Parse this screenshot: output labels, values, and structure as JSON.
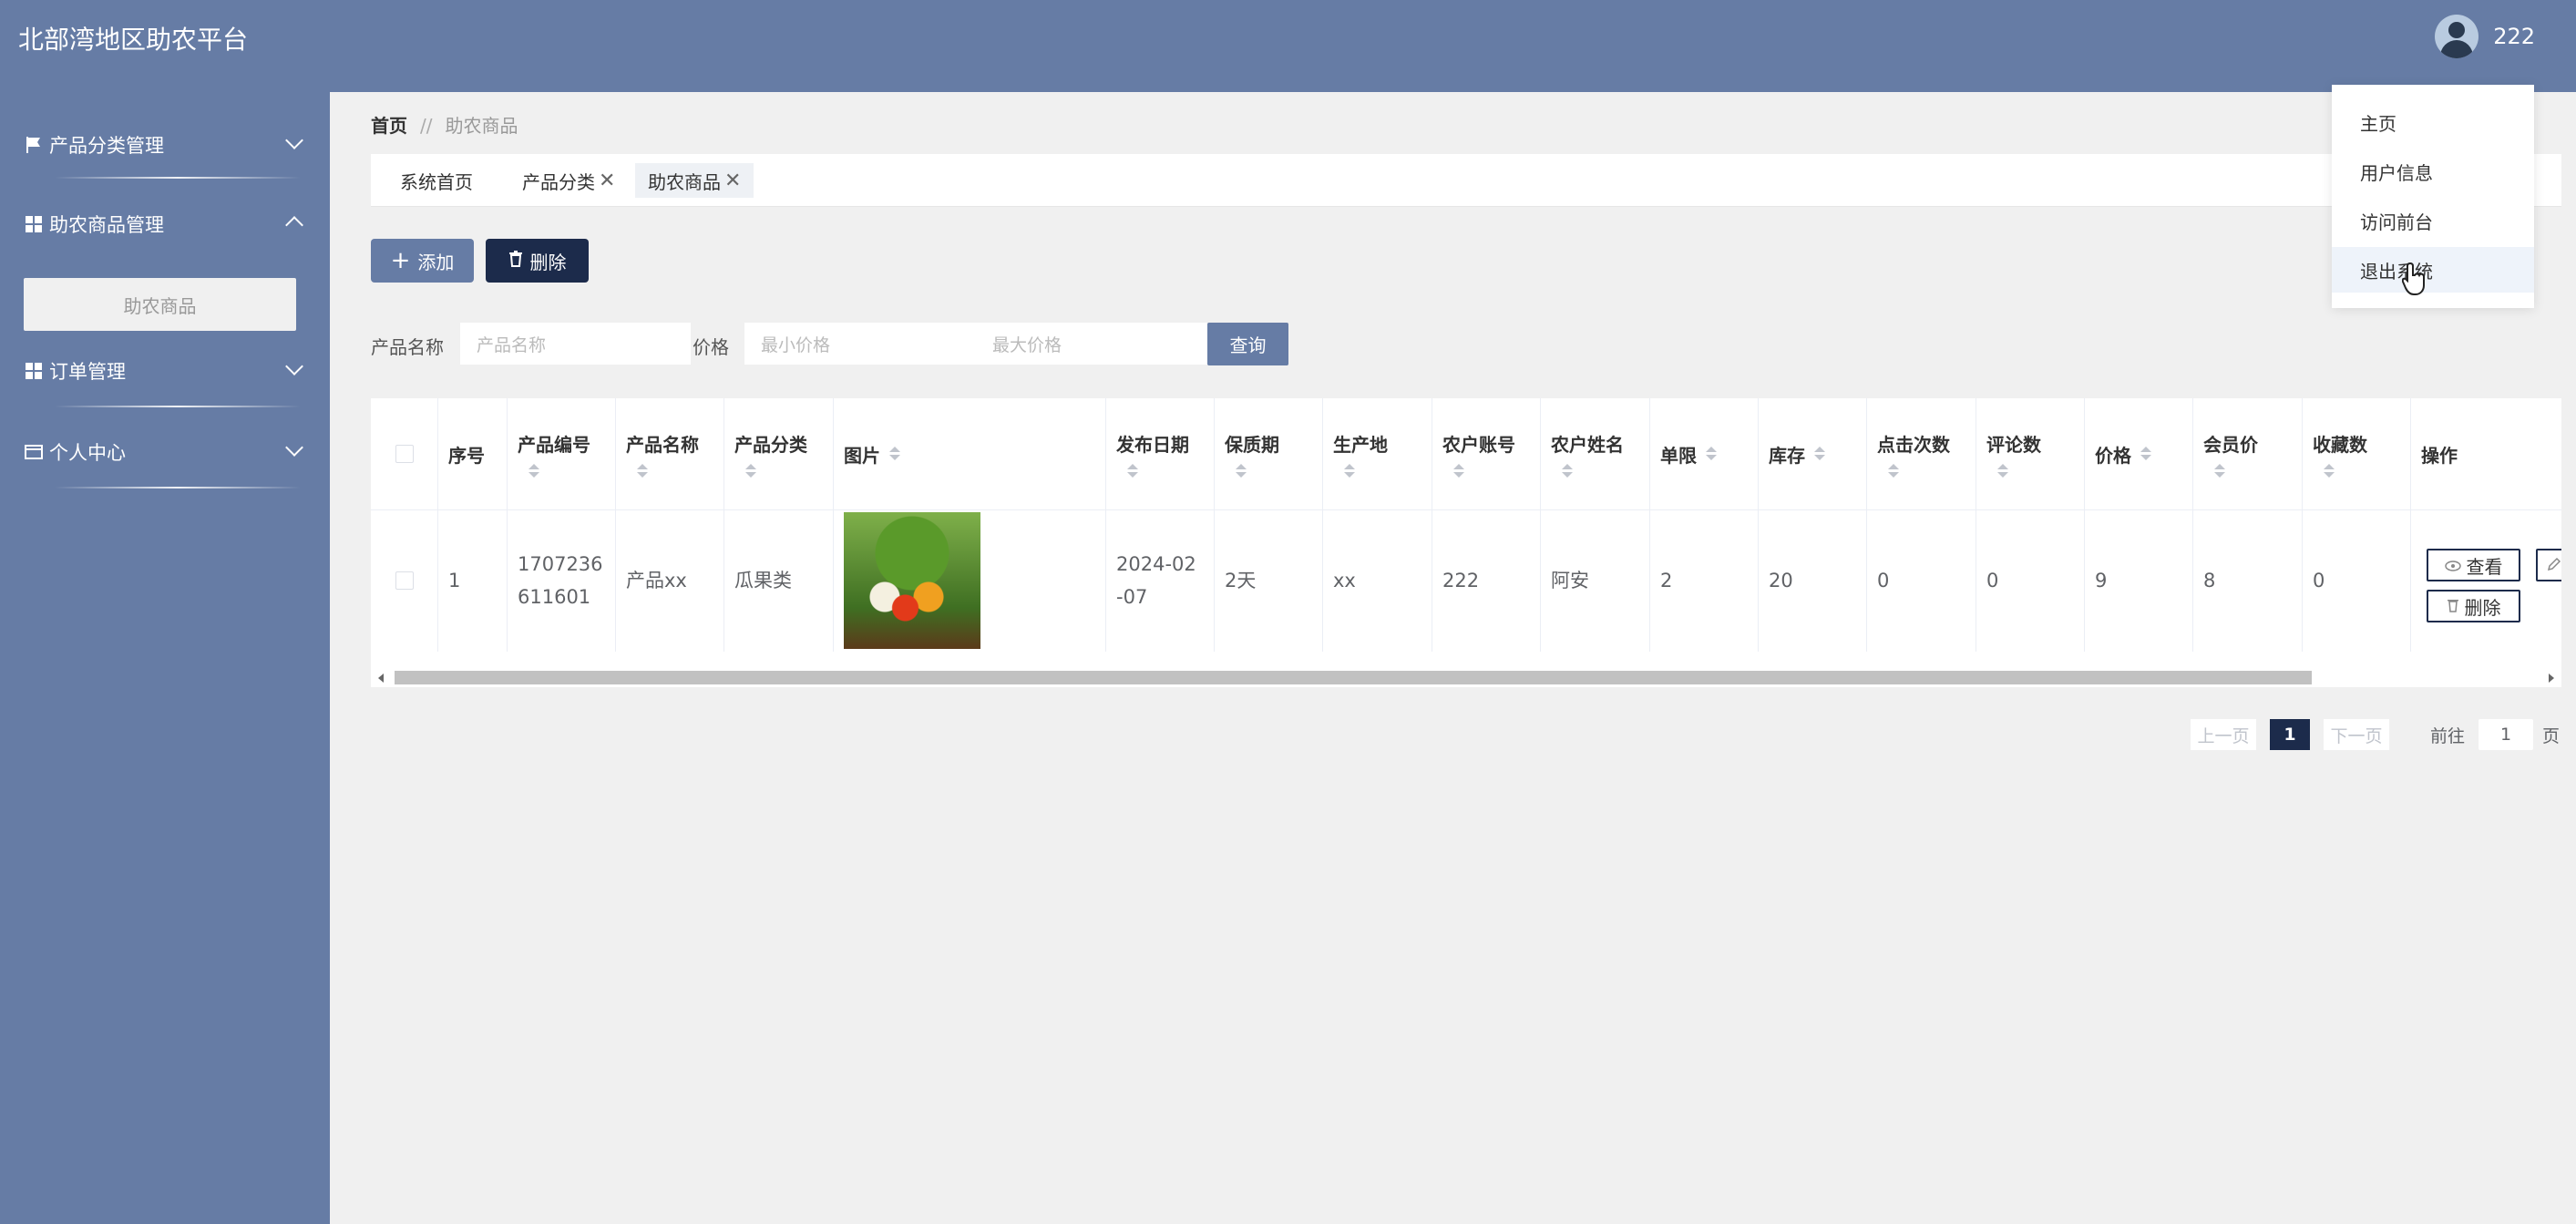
{
  "header": {
    "app_title": "北部湾地区助农平台",
    "username": "222"
  },
  "sidebar": {
    "items": [
      {
        "label": "产品分类管理",
        "icon": "flag-icon"
      },
      {
        "label": "助农商品管理",
        "icon": "grid-icon",
        "expanded": true,
        "submenu": [
          "助农商品"
        ]
      },
      {
        "label": "订单管理",
        "icon": "grid-icon"
      },
      {
        "label": "个人中心",
        "icon": "card-icon"
      }
    ]
  },
  "breadcrumb": {
    "home": "首页",
    "separator": "//",
    "current": "助农商品"
  },
  "tabs": [
    {
      "label": "系统首页"
    },
    {
      "label": "产品分类",
      "close": "✕"
    },
    {
      "label": "助农商品",
      "close": "✕"
    }
  ],
  "toolbar": {
    "add_label": "添加",
    "delete_label": "删除"
  },
  "search": {
    "name_label": "产品名称",
    "name_placeholder": "产品名称",
    "price_label": "价格",
    "min_price_placeholder": "最小价格",
    "max_price_placeholder": "最大价格",
    "query_label": "查询"
  },
  "table": {
    "columns": [
      "序号",
      "产品编号",
      "产品名称",
      "产品分类",
      "图片",
      "发布日期",
      "保质期",
      "生产地",
      "农户账号",
      "农户姓名",
      "单限",
      "库存",
      "点击次数",
      "评论数",
      "价格",
      "会员价",
      "收藏数",
      "操作"
    ],
    "rows": [
      {
        "index": "1",
        "code": "1707236611601",
        "code_line1": "1707236",
        "code_line2": "611601",
        "name": "产品xx",
        "category": "瓜果类",
        "date_line1": "2024-02",
        "date_line2": "-07",
        "shelf_life": "2天",
        "origin": "xx",
        "farmer_account": "222",
        "farmer_name": "阿安",
        "limit": "2",
        "stock": "20",
        "clicks": "0",
        "comments": "0",
        "price": "9",
        "member_price": "8",
        "favorites": "0",
        "view_label": "查看",
        "delete_label": "删除"
      }
    ]
  },
  "pagination": {
    "prev": "上一页",
    "current": "1",
    "next": "下一页",
    "goto_label": "前往",
    "goto_value": "1",
    "page_suffix": "页"
  },
  "dropdown": {
    "items": [
      "主页",
      "用户信息",
      "访问前台",
      "退出系统"
    ]
  }
}
